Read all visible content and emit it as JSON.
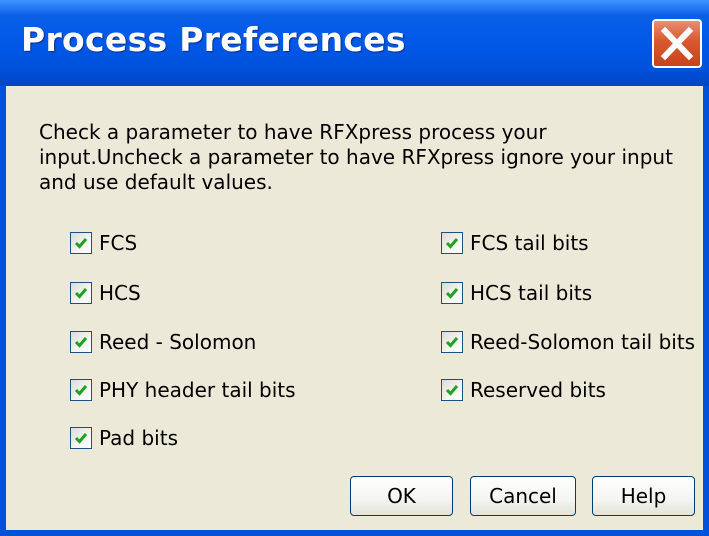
{
  "window": {
    "title": "Process Preferences",
    "close_icon": "close-icon"
  },
  "instructions": "Check a parameter to have RFXpress process your input.Uncheck a parameter to have RFXpress ignore your input and use default values.",
  "options_left": [
    {
      "label": "FCS",
      "checked": true
    },
    {
      "label": "HCS",
      "checked": true
    },
    {
      "label": "Reed - Solomon",
      "checked": true
    },
    {
      "label": "PHY header tail bits",
      "checked": true
    },
    {
      "label": "Pad bits",
      "checked": true
    }
  ],
  "options_right": [
    {
      "label": "FCS tail bits",
      "checked": true
    },
    {
      "label": "HCS tail bits",
      "checked": true
    },
    {
      "label": "Reed-Solomon tail bits",
      "checked": true
    },
    {
      "label": "Reserved bits",
      "checked": true
    }
  ],
  "buttons": {
    "ok": "OK",
    "cancel": "Cancel",
    "help": "Help"
  },
  "colors": {
    "titlebar": "#0058E8",
    "dialog_bg": "#ECE9D8",
    "checkmark": "#21A121",
    "close_button": "#D9582F"
  }
}
